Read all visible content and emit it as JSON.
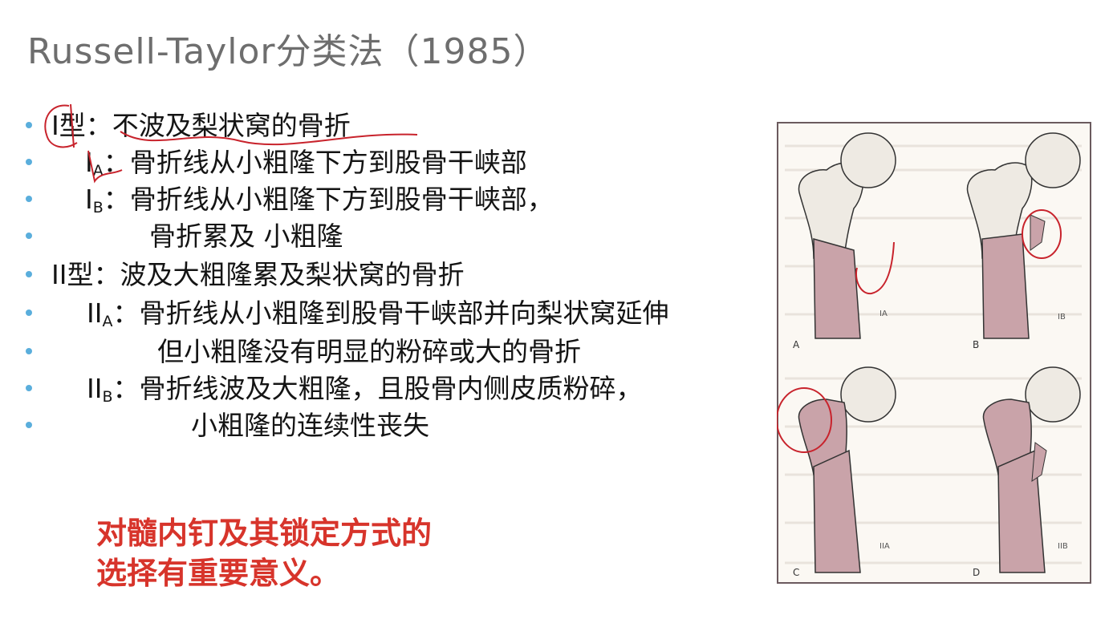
{
  "title": "Russell-Taylor分类法（1985）",
  "bullets": [
    {
      "main": "I型：不波及梨状窝的骨折"
    },
    {
      "pre": "I",
      "sub": "A",
      "main": "：骨折线从小粗隆下方到股骨干峡部"
    },
    {
      "pre": "I",
      "sub": "B",
      "main": "：骨折线从小粗隆下方到股骨干峡部，"
    },
    {
      "main": "骨折累及 小粗隆"
    },
    {
      "main": "II型：波及大粗隆累及梨状窝的骨折"
    },
    {
      "pre": "II",
      "sub": "A",
      "main": "：骨折线从小粗隆到股骨干峡部并向梨状窝延伸"
    },
    {
      "main": "但小粗隆没有明显的粉碎或大的骨折"
    },
    {
      "pre": "II",
      "sub": "B",
      "main": "：骨折线波及大粗隆，且股骨内侧皮质粉碎，"
    },
    {
      "main": "小粗隆的连续性丧失"
    }
  ],
  "note": {
    "line1": "对髓内钉及其锁定方式的",
    "line2": "选择有重要意义。"
  },
  "figure": {
    "labels": [
      "IA",
      "IB",
      "IIA",
      "IIB"
    ],
    "letters": [
      "A",
      "B",
      "C",
      "D"
    ]
  },
  "colors": {
    "title": "#6e6e6e",
    "bullet_dot": "#5aaedc",
    "note": "#d7342b",
    "annotation": "#c8232c",
    "bone_shaft": "#c9a3a9"
  }
}
